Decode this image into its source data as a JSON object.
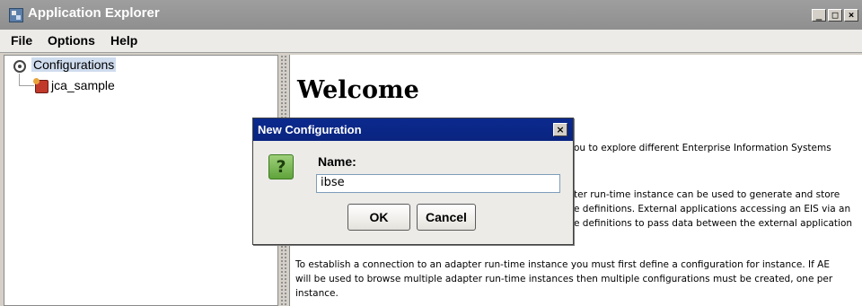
{
  "window": {
    "title": "Application Explorer",
    "controls": [
      "_",
      "□",
      "×"
    ]
  },
  "menu": {
    "items": [
      {
        "label": "File"
      },
      {
        "label": "Options"
      },
      {
        "label": "Help"
      }
    ]
  },
  "tree": {
    "root": {
      "label": "Configurations",
      "icon": "configurations-icon",
      "selected": true
    },
    "children": [
      {
        "label": "jca_sample",
        "icon": "configuration-node-icon"
      }
    ]
  },
  "content": {
    "heading": "Welcome",
    "paragraph1_lines": [
      "ou to explore different Enterprise Information Systems"
    ],
    "paragraph2_lines": [
      "ter run-time instance can be used to generate and store",
      "e definitions. External applications accessing an EIS via an",
      "e definitions to pass data between the external application"
    ],
    "paragraph3_lines": [
      "To establish a connection to an adapter run-time instance you must first define a configuration for instance. If AE",
      "will be used to browse multiple adapter run-time instances then multiple configurations must be created, one per",
      "instance."
    ]
  },
  "dialog": {
    "title": "New Configuration",
    "close_label": "×",
    "icon_glyph": "?",
    "name_label": "Name:",
    "name_value": "ibse",
    "ok_label": "OK",
    "cancel_label": "Cancel"
  }
}
